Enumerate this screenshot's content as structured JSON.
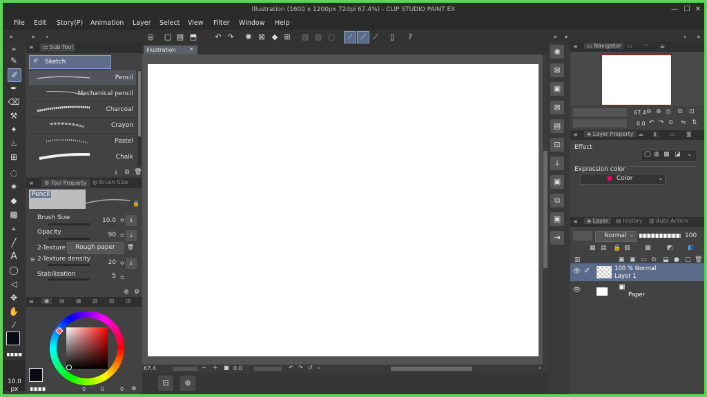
{
  "titlebar": {
    "title": "Illustration (1600 x 1200px 72dpi 67.4%) - CLIP STUDIO PAINT EX"
  },
  "menu": [
    "File",
    "Edit",
    "Story(P)",
    "Animation",
    "Layer",
    "Select",
    "View",
    "Filter",
    "Window",
    "Help"
  ],
  "subtool": {
    "tab_label": "Sub Tool",
    "group": "Sketch",
    "brushes": [
      "Pencil",
      "Mechanical pencil",
      "Charcoal",
      "Crayon",
      "Pastel",
      "Chalk"
    ]
  },
  "toolprop": {
    "tab1": "Tool Property",
    "tab2": "Brush Size",
    "preview_label": "Pencil",
    "rows": [
      {
        "label": "Brush Size",
        "value": "10.0"
      },
      {
        "label": "Opacity",
        "value": "90"
      },
      {
        "label": "2-Texture",
        "value": "Rough paper"
      },
      {
        "label": "2-Texture density",
        "value": "20"
      },
      {
        "label": "Stabilization",
        "value": "5"
      }
    ]
  },
  "color": {
    "main": "#0a0a14",
    "sub": "#ffffff",
    "values": [
      "0",
      "0",
      "0"
    ]
  },
  "brushsize": {
    "value": "10.0",
    "unit": "px"
  },
  "canvas": {
    "tab": "Illustration",
    "zoom": "67.4",
    "angle": "0.0"
  },
  "navigator": {
    "tab": "Navigator",
    "zoom": "67.4",
    "angle": "0.0"
  },
  "layerprop": {
    "tab": "Layer Property",
    "effect_label": "Effect",
    "expr_label": "Expression color",
    "expr_value": "Color"
  },
  "layer": {
    "tabs": [
      "Layer",
      "History",
      "Auto Action"
    ],
    "blend": "Normal",
    "opacity": "100",
    "layers": [
      {
        "line1": "100 % Normal",
        "line2": "Layer 1"
      },
      {
        "line1": "",
        "line2": "Paper"
      }
    ]
  }
}
